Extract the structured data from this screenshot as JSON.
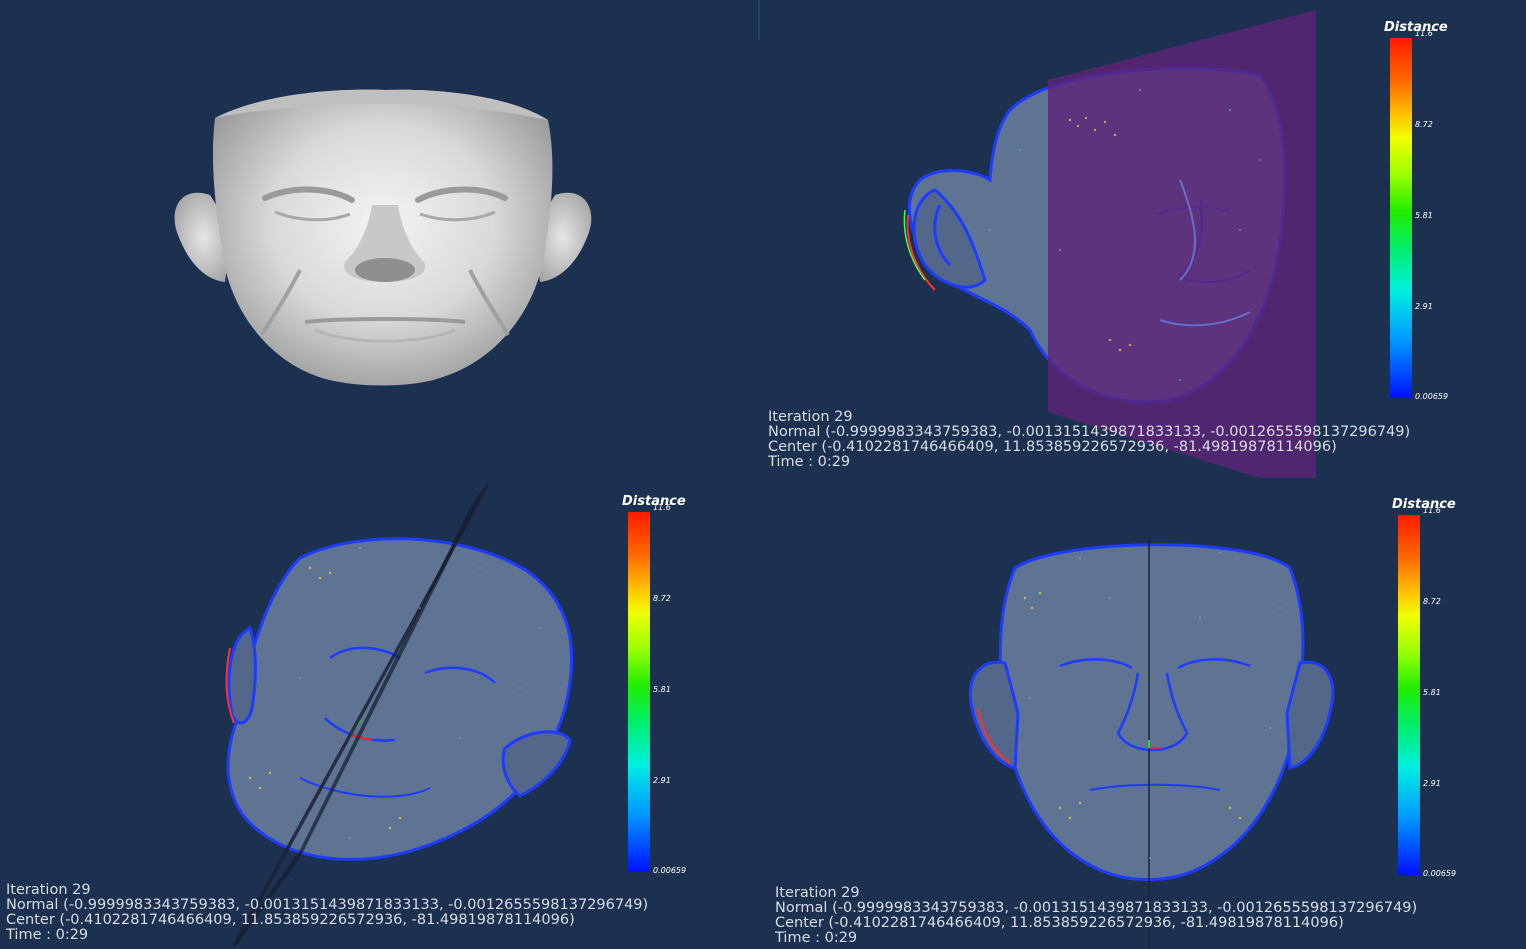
{
  "viewports": {
    "top_left": {
      "name": "surface-render-view"
    },
    "top_right": {
      "info": {
        "iteration": "Iteration 29",
        "normal": "Normal (-0.9999983343759383, -0.0013151439871833133, -0.0012655598137296749)",
        "center": "Center (-0.4102281746466409, 11.853859226572936, -81.49819878114096)",
        "time": "Time : 0:29"
      },
      "colorbar": {
        "title": "Distance",
        "ticks": [
          "11.6",
          "8.72",
          "5.81",
          "2.91",
          "0.00659"
        ]
      }
    },
    "bottom_left": {
      "info": {
        "iteration": "Iteration 29",
        "normal": "Normal (-0.9999983343759383, -0.0013151439871833133, -0.0012655598137296749)",
        "center": "Center (-0.4102281746466409, 11.853859226572936, -81.49819878114096)",
        "time": "Time : 0:29"
      },
      "colorbar": {
        "title": "Distance",
        "ticks": [
          "11.6",
          "8.72",
          "5.81",
          "2.91",
          "0.00659"
        ]
      }
    },
    "bottom_right": {
      "info": {
        "iteration": "Iteration 29",
        "normal": "Normal (-0.9999983343759383, -0.0013151439871833133, -0.0012655598137296749)",
        "center": "Center (-0.4102281746466409, 11.853859226572936, -81.49819878114096)",
        "time": "Time : 0:29"
      },
      "colorbar": {
        "title": "Distance",
        "ticks": [
          "11.6",
          "8.72",
          "5.81",
          "2.91",
          "0.00659"
        ]
      }
    }
  },
  "colors": {
    "background": "#1c3150",
    "plane_purple": "#5b2478",
    "plane_dark": "#1a2236",
    "mesh_face": "#5f7392",
    "mesh_edge": "#1e3cff",
    "surface": "#d9d9d9",
    "info_text": "#d8dde4"
  }
}
